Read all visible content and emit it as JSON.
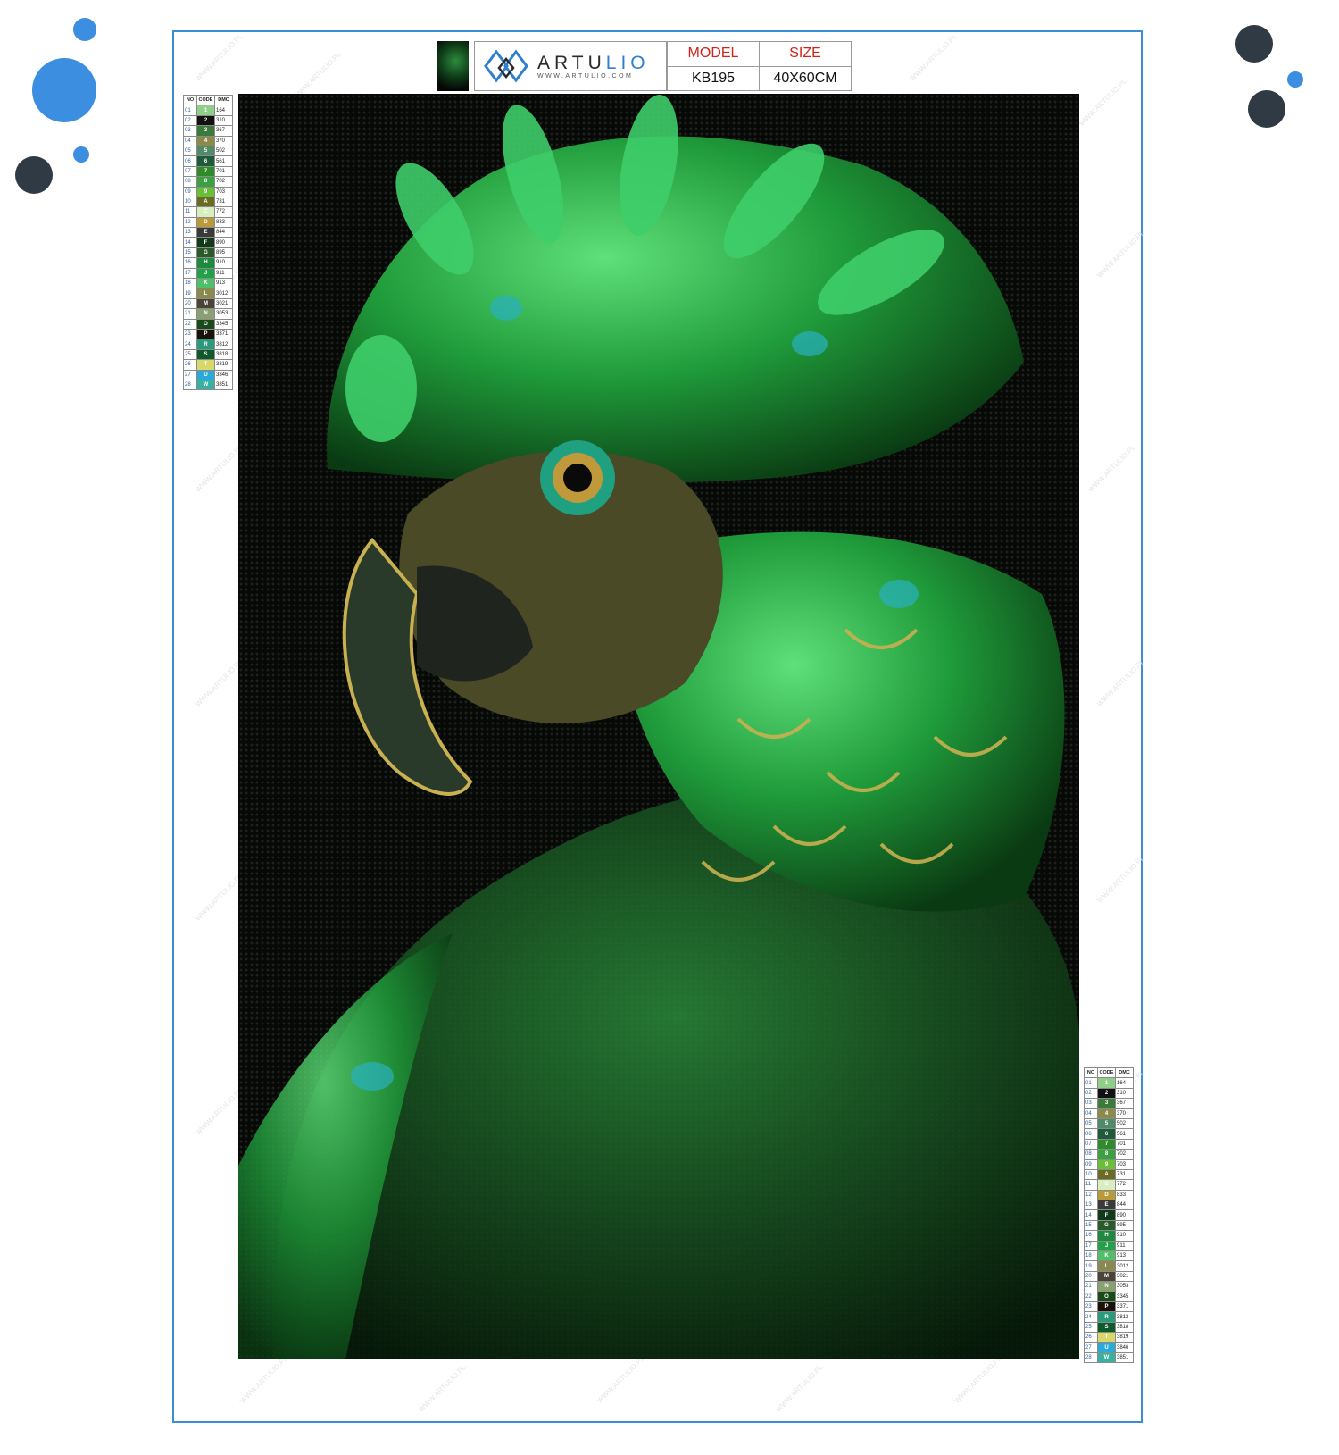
{
  "brand": {
    "name_part1": "ARTU",
    "name_part2": "LIO",
    "url": "WWW.ARTULIO.COM"
  },
  "spec": {
    "model_label": "MODEL",
    "size_label": "SIZE",
    "model_value": "KB195",
    "size_value": "40X60CM"
  },
  "legend": {
    "headers": [
      "NO",
      "CODE",
      "DMC"
    ],
    "rows": [
      {
        "no": "01",
        "code": "1",
        "dmc": "164",
        "color": "#8fcf8a"
      },
      {
        "no": "02",
        "code": "2",
        "dmc": "310",
        "color": "#111111"
      },
      {
        "no": "03",
        "code": "3",
        "dmc": "367",
        "color": "#3b7a3a"
      },
      {
        "no": "04",
        "code": "4",
        "dmc": "370",
        "color": "#8c8a4a"
      },
      {
        "no": "05",
        "code": "5",
        "dmc": "502",
        "color": "#4f8a6a"
      },
      {
        "no": "06",
        "code": "6",
        "dmc": "561",
        "color": "#1f5a3a"
      },
      {
        "no": "07",
        "code": "7",
        "dmc": "701",
        "color": "#2f8a2a"
      },
      {
        "no": "08",
        "code": "8",
        "dmc": "702",
        "color": "#3aa040"
      },
      {
        "no": "09",
        "code": "9",
        "dmc": "703",
        "color": "#6abf3a"
      },
      {
        "no": "10",
        "code": "A",
        "dmc": "731",
        "color": "#6a6a20"
      },
      {
        "no": "11",
        "code": "C",
        "dmc": "772",
        "color": "#d8edc0"
      },
      {
        "no": "12",
        "code": "D",
        "dmc": "833",
        "color": "#b89a3a"
      },
      {
        "no": "13",
        "code": "E",
        "dmc": "844",
        "color": "#3a3a3a"
      },
      {
        "no": "14",
        "code": "F",
        "dmc": "890",
        "color": "#123a1a"
      },
      {
        "no": "15",
        "code": "G",
        "dmc": "895",
        "color": "#2a5a2a"
      },
      {
        "no": "16",
        "code": "H",
        "dmc": "910",
        "color": "#1f8a3f"
      },
      {
        "no": "17",
        "code": "J",
        "dmc": "911",
        "color": "#22a04a"
      },
      {
        "no": "18",
        "code": "K",
        "dmc": "913",
        "color": "#4fbf6a"
      },
      {
        "no": "19",
        "code": "L",
        "dmc": "3012",
        "color": "#8a8a50"
      },
      {
        "no": "20",
        "code": "M",
        "dmc": "3021",
        "color": "#4a4438"
      },
      {
        "no": "21",
        "code": "N",
        "dmc": "3053",
        "color": "#8aa070"
      },
      {
        "no": "22",
        "code": "O",
        "dmc": "3345",
        "color": "#1a4a1a"
      },
      {
        "no": "23",
        "code": "P",
        "dmc": "3371",
        "color": "#1a120a"
      },
      {
        "no": "24",
        "code": "R",
        "dmc": "3812",
        "color": "#2a9a7a"
      },
      {
        "no": "25",
        "code": "S",
        "dmc": "3818",
        "color": "#0f5a2a"
      },
      {
        "no": "26",
        "code": "T",
        "dmc": "3819",
        "color": "#d8d86a"
      },
      {
        "no": "27",
        "code": "U",
        "dmc": "3846",
        "color": "#2aaad8"
      },
      {
        "no": "28",
        "code": "W",
        "dmc": "3851",
        "color": "#3ab0a0"
      }
    ]
  },
  "watermark": "WWW.ARTULIO.PL",
  "colors": {
    "frame_border": "#3a8ed6",
    "accent_blue": "#3b8ee0",
    "dark_dot": "#2f3a44",
    "spec_header_red": "#d0231a"
  },
  "artwork": {
    "subject_icon": "parrot-icon"
  }
}
